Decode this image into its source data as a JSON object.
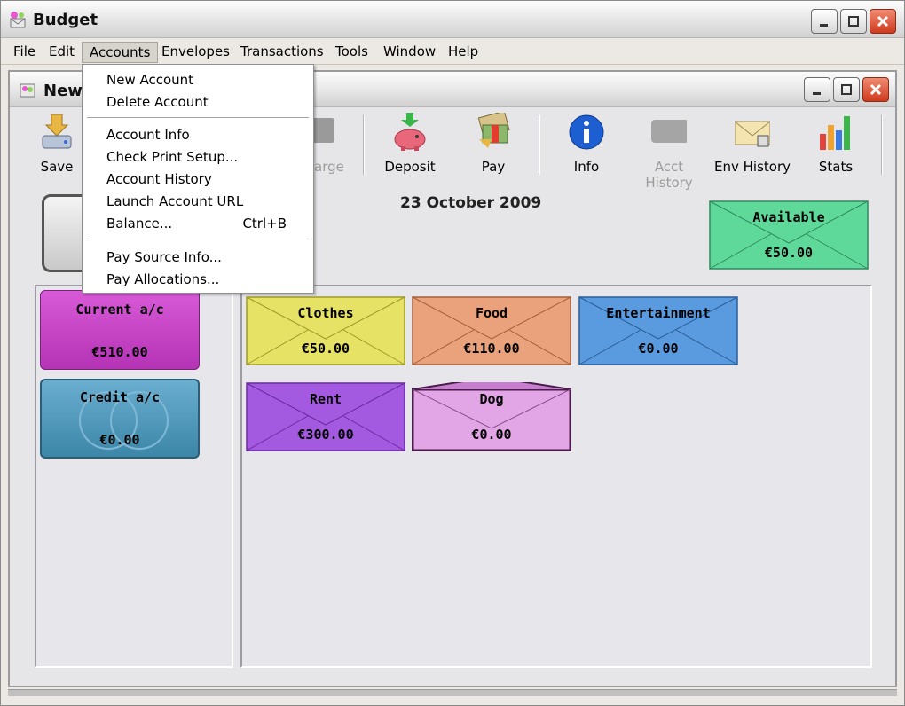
{
  "app": {
    "title": "Budget"
  },
  "menubar": {
    "items": [
      "File",
      "Edit",
      "Accounts",
      "Envelopes",
      "Transactions",
      "Tools",
      "Window",
      "Help"
    ]
  },
  "inner_window": {
    "title": "New"
  },
  "toolbar": {
    "save": "Save",
    "charge": "Charge",
    "deposit": "Deposit",
    "pay": "Pay",
    "info": "Info",
    "acct_history": "Acct History",
    "env_history": "Env History",
    "stats": "Stats"
  },
  "date": "23 October 2009",
  "accounts_menu": {
    "items": [
      {
        "label": "New Account",
        "shortcut": ""
      },
      {
        "label": "Delete Account",
        "shortcut": ""
      },
      {
        "label": "Account Info",
        "shortcut": ""
      },
      {
        "label": "Check Print Setup...",
        "shortcut": ""
      },
      {
        "label": "Account History",
        "shortcut": ""
      },
      {
        "label": "Launch Account URL",
        "shortcut": ""
      },
      {
        "label": "Balance...",
        "shortcut": "Ctrl+B"
      },
      {
        "label": "Pay Source Info...",
        "shortcut": ""
      },
      {
        "label": "Pay Allocations...",
        "shortcut": ""
      }
    ]
  },
  "available": {
    "name": "Available",
    "amount": "€50.00",
    "color": "#5fd99a"
  },
  "accounts": [
    {
      "name": "Current a/c",
      "amount": "€510.00",
      "color": "#cc44cc"
    },
    {
      "name": "Credit a/c",
      "amount": "€0.00",
      "color": "#4f97b8"
    }
  ],
  "envelopes": [
    {
      "name": "Clothes",
      "amount": "€50.00",
      "color": "#e5e265"
    },
    {
      "name": "Food",
      "amount": "€110.00",
      "color": "#e9a27c"
    },
    {
      "name": "Entertainment",
      "amount": "€0.00",
      "color": "#5a9be0"
    },
    {
      "name": "Rent",
      "amount": "€300.00",
      "color": "#a45ae0"
    },
    {
      "name": "Dog",
      "amount": "€0.00",
      "color": "#e2a6e6"
    }
  ]
}
